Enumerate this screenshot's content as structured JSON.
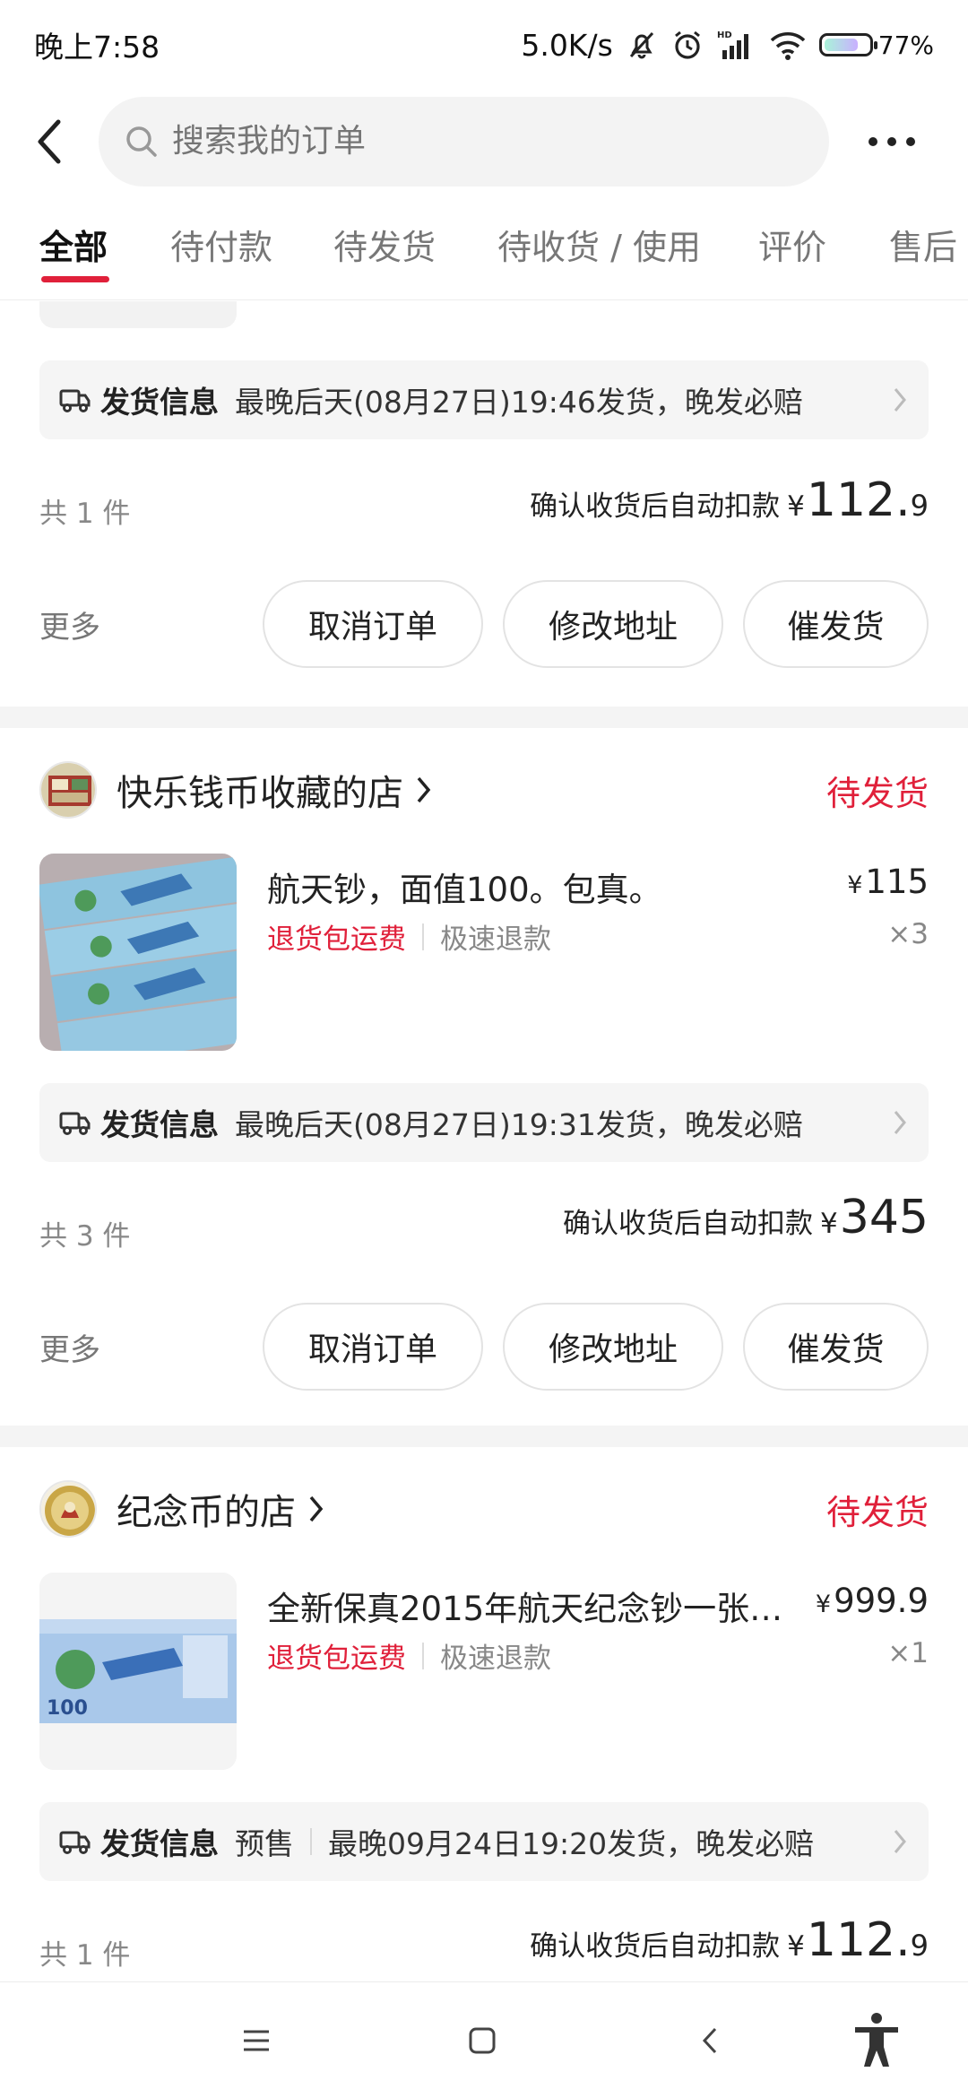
{
  "status_bar": {
    "time": "晚上7:58",
    "net_speed": "5.0K/s",
    "battery": "77%",
    "icons": [
      "mute-bell-icon",
      "alarm-icon",
      "hd-signal-icon",
      "wifi-icon",
      "battery-icon"
    ]
  },
  "header": {
    "search_placeholder": "搜索我的订单",
    "icons": [
      "back-arrow-icon",
      "search-icon",
      "more-dots-icon"
    ]
  },
  "tabs": [
    "全部",
    "待付款",
    "待发货",
    "待收货 / 使用",
    "评价",
    "售后"
  ],
  "active_tab": "全部",
  "orders": [
    {
      "ship_label": "发货信息",
      "ship_text": "最晚后天(08月27日)19:46发货，晚发必赔",
      "count": "共 1 件",
      "total_label": "确认收货后自动扣款",
      "total_yen": "¥",
      "total_int": "112.",
      "total_dec": "9",
      "more": "更多",
      "buttons": [
        "取消订单",
        "修改地址",
        "催发货"
      ]
    },
    {
      "shop": "快乐钱币收藏的店",
      "status": "待发货",
      "product": "航天钞，面值100。包真。",
      "tag1": "退货包运费",
      "tag2": "极速退款",
      "price_yen": "¥",
      "price": "115",
      "qty": "×3",
      "ship_label": "发货信息",
      "ship_text": "最晚后天(08月27日)19:31发货，晚发必赔",
      "count": "共 3 件",
      "total_label": "确认收货后自动扣款",
      "total_yen": "¥",
      "total_int": "345",
      "total_dec": "",
      "more": "更多",
      "buttons": [
        "取消订单",
        "修改地址",
        "催发货"
      ]
    },
    {
      "shop": "纪念币的店",
      "status": "待发货",
      "product": "全新保真2015年航天纪念钞一张…",
      "tag1": "退货包运费",
      "tag2": "极速退款",
      "price_yen": "¥",
      "price": "999.9",
      "qty": "×1",
      "ship_label": "发货信息",
      "ship_presale": "预售",
      "ship_text": "最晚09月24日19:20发货，晚发必赔",
      "count": "共 1 件",
      "total_label": "确认收货后自动扣款",
      "total_yen": "¥",
      "total_int": "112.",
      "total_dec": "9"
    }
  ],
  "colors": {
    "accent": "#e0203a",
    "background_gap": "#f4f4f4",
    "ship_bar": "#f5f5f5"
  },
  "navbar_icons": [
    "menu-icon",
    "home-square-icon",
    "back-chevron-icon",
    "accessibility-icon"
  ]
}
